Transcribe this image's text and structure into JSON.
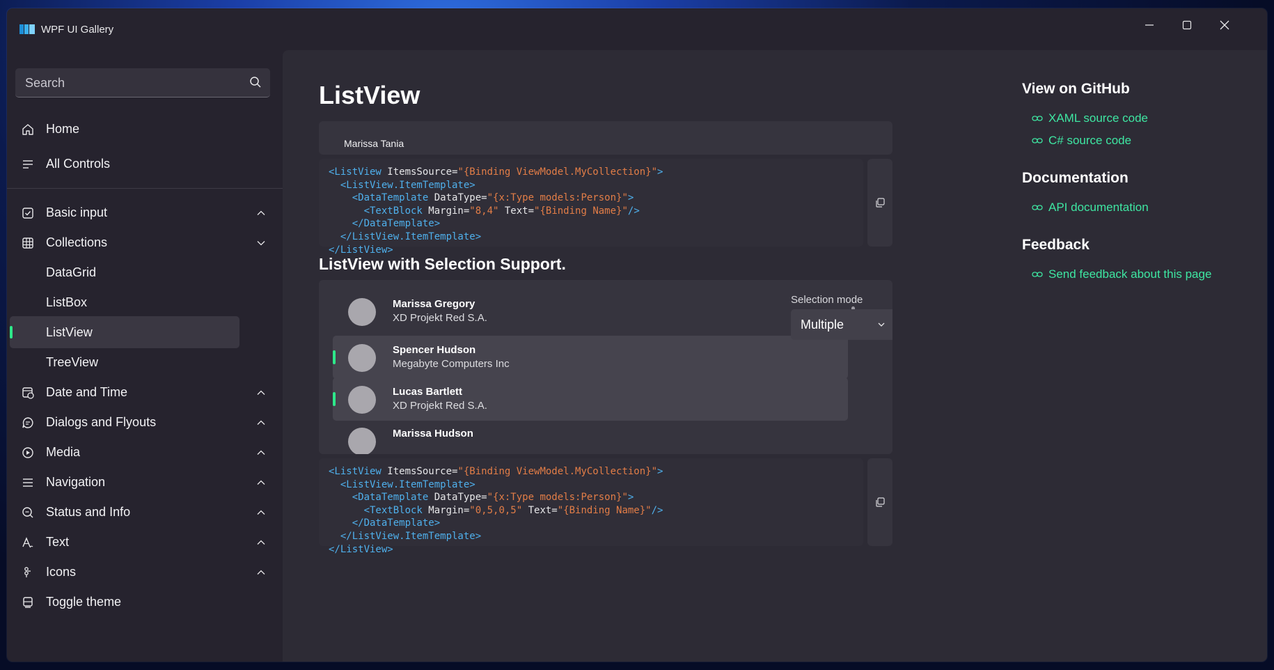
{
  "app": {
    "title": "WPF UI Gallery"
  },
  "search": {
    "placeholder": "Search"
  },
  "nav": {
    "home": "Home",
    "all_controls": "All Controls",
    "basic_input": "Basic input",
    "collections": "Collections",
    "datagrid": "DataGrid",
    "listbox": "ListBox",
    "listview": "ListView",
    "treeview": "TreeView",
    "date_time": "Date and Time",
    "dialogs": "Dialogs and Flyouts",
    "media": "Media",
    "navigation": "Navigation",
    "status": "Status and Info",
    "text": "Text",
    "icons": "Icons",
    "toggle_theme": "Toggle theme"
  },
  "page": {
    "title": "ListView",
    "sample1": {
      "visible_item": "Marissa Tania"
    },
    "code1": {
      "l1": {
        "tag": "<ListView",
        "attr": " ItemsSource=",
        "val": "\"{Binding ViewModel.MyCollection}\"",
        "end": ">"
      },
      "l2": {
        "tag": "  <ListView.ItemTemplate>"
      },
      "l3": {
        "tag": "    <DataTemplate",
        "attr": " DataType=",
        "val": "\"{x:Type models:Person}\"",
        "end": ">"
      },
      "l4": {
        "tag": "      <TextBlock",
        "attr": " Margin=",
        "val": "\"8,4\"",
        "attr2": " Text=",
        "val2": "\"{Binding Name}\"",
        "end": "/>"
      },
      "l5": {
        "tag": "    </DataTemplate>"
      },
      "l6": {
        "tag": "  </ListView.ItemTemplate>"
      },
      "l7": {
        "tag": "</ListView>"
      }
    },
    "section2_title": "ListView with Selection Support.",
    "people": [
      {
        "name": "Marissa Gregory",
        "company": "XD Projekt Red S.A."
      },
      {
        "name": "Spencer Hudson",
        "company": "Megabyte Computers Inc"
      },
      {
        "name": "Lucas Bartlett",
        "company": "XD Projekt Red S.A."
      },
      {
        "name": "Marissa Hudson",
        "company": ""
      }
    ],
    "selection_mode_label": "Selection mode",
    "selection_mode_value": "Multiple",
    "code2": {
      "l1": {
        "tag": "<ListView",
        "attr": " ItemsSource=",
        "val": "\"{Binding ViewModel.MyCollection}\"",
        "end": ">"
      },
      "l2": {
        "tag": "  <ListView.ItemTemplate>"
      },
      "l3": {
        "tag": "    <DataTemplate",
        "attr": " DataType=",
        "val": "\"{x:Type models:Person}\"",
        "end": ">"
      },
      "l4": {
        "tag": "      <TextBlock",
        "attr": " Margin=",
        "val": "\"0,5,0,5\"",
        "attr2": " Text=",
        "val2": "\"{Binding Name}\"",
        "end": "/>"
      },
      "l5": {
        "tag": "    </DataTemplate>"
      },
      "l6": {
        "tag": "  </ListView.ItemTemplate>"
      },
      "l7": {
        "tag": "</ListView>"
      }
    }
  },
  "right": {
    "github_title": "View on GitHub",
    "xaml_link": "XAML source code",
    "cs_link": "C# source code",
    "docs_title": "Documentation",
    "api_link": "API documentation",
    "feedback_title": "Feedback",
    "feedback_link": "Send feedback about this page"
  },
  "colors": {
    "accent": "#2ee88a",
    "link": "#3ee6a2",
    "background": "#26232e",
    "content": "#2d2b35"
  }
}
